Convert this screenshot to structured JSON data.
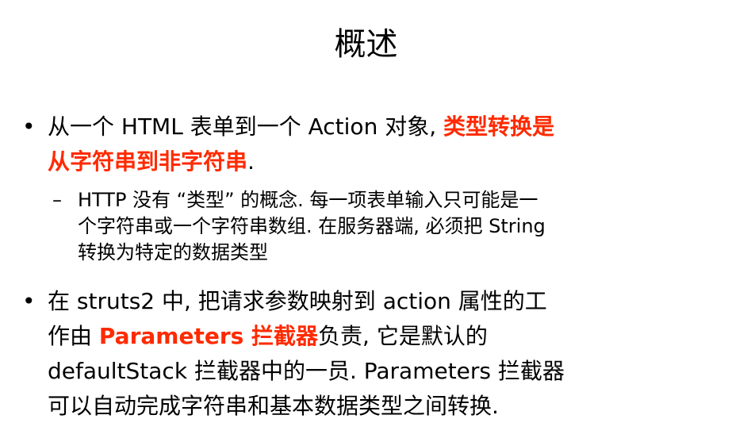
{
  "slide": {
    "title": "概述",
    "bullet1": {
      "marker": "•",
      "line1_plain": "从一个 HTML 表单到一个 Action 对象, ",
      "line1_red": "类型转换是",
      "line2_red": "从字符串到非字符串",
      "line2_plain": "."
    },
    "subbullet": {
      "marker": "–",
      "line1": "HTTP 没有 “类型” 的概念. 每一项表单输入只可能是一",
      "line2": "个字符串或一个字符串数组. 在服务器端, 必须把 String",
      "line3": "转换为特定的数据类型"
    },
    "bullet2": {
      "marker": "•",
      "line1": "在 struts2 中, 把请求参数映射到 action  属性的工",
      "line2_prefix": "作由 ",
      "line2_red": "Parameters 拦截器",
      "line2_suffix": "负责, 它是默认的",
      "line3": "defaultStack 拦截器中的一员. Parameters 拦截器",
      "line4": "可以自动完成字符串和基本数据类型之间转换."
    }
  }
}
